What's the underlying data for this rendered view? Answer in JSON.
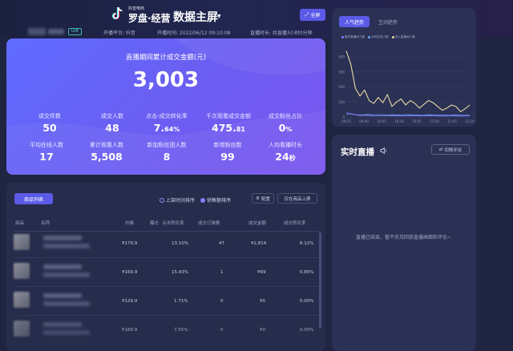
{
  "header": {
    "brand_top": "抖音电商",
    "brand_name": "罗盘·经营",
    "title": "数据主屏",
    "fullscreen_label": "全屏",
    "level_badge": "LV8",
    "platform": "开播平台: 抖音",
    "start_time": "开播时间: 2022/06/12 09:10:08",
    "duration": "直播时长: 共直播3小时0分钟"
  },
  "hero": {
    "label": "直播期间累计成交金额(元)",
    "value": "3,003",
    "metrics": [
      {
        "label": "成交件数",
        "value": "50",
        "suffix": ""
      },
      {
        "label": "成交人数",
        "value": "48",
        "suffix": ""
      },
      {
        "label": "点击-成交转化率",
        "value": "7.",
        "suffix": "64%"
      },
      {
        "label": "千次观看成交金额",
        "value": "475.",
        "suffix": "81"
      },
      {
        "label": "成交粉丝占比",
        "value": "0",
        "suffix": "%"
      },
      {
        "label": "平均在线人数",
        "value": "17",
        "suffix": ""
      },
      {
        "label": "累计观看人数",
        "value": "5,508",
        "suffix": ""
      },
      {
        "label": "新加粉丝团人数",
        "value": "8",
        "suffix": ""
      },
      {
        "label": "新增粉丝数",
        "value": "99",
        "suffix": ""
      },
      {
        "label": "人均看播时长",
        "value": "24",
        "suffix": "秒"
      }
    ]
  },
  "trend": {
    "tabs": [
      "人气趋势",
      "互动趋势"
    ],
    "legend": [
      {
        "name": "离开直播间人数",
        "color": "#8a7bff"
      },
      {
        "name": "实时在线人数",
        "color": "#6fa8ff"
      },
      {
        "name": "进入直播间人数",
        "color": "#e9d8a6"
      }
    ],
    "y_ticks": [
      "400",
      "300",
      "200",
      "100",
      "0"
    ],
    "x_ticks": [
      "09:15",
      "09:40",
      "10:05",
      "10:30",
      "10:55",
      "11:20",
      "11:45",
      "12:10"
    ],
    "chart_data": {
      "type": "line",
      "x": [
        "09:15",
        "09:40",
        "10:05",
        "10:30",
        "10:55",
        "11:20",
        "11:45",
        "12:10"
      ],
      "ylim": [
        0,
        480
      ],
      "series": [
        {
          "name": "进入直播间人数",
          "values": [
            440,
            350,
            190,
            140,
            180,
            110,
            90,
            130,
            95,
            150,
            70,
            100,
            120,
            80,
            110,
            90,
            60,
            85,
            110,
            95,
            70,
            45,
            60,
            80,
            70,
            35,
            55,
            80
          ]
        },
        {
          "name": "实时在线人数",
          "values": [
            18,
            22,
            16,
            14,
            15,
            17,
            12,
            14,
            16,
            13,
            15,
            14,
            12,
            16,
            15,
            14,
            12,
            13,
            15,
            14,
            12,
            13,
            11,
            12,
            14,
            12,
            11,
            12
          ]
        },
        {
          "name": "离开直播间人数",
          "values": [
            30,
            20,
            15,
            10,
            12,
            10,
            9,
            10,
            8,
            10,
            7,
            9,
            8,
            7,
            9,
            8,
            7,
            8,
            9,
            8,
            7,
            6,
            7,
            8,
            7,
            6,
            7,
            8
          ]
        }
      ]
    }
  },
  "live": {
    "title": "实时直播",
    "switch_label": "切换评论",
    "message": "直播已结束，暂不支持回放直播画面和评论~"
  },
  "products": {
    "tab_label": "商品列表",
    "sort_options": [
      "上架时间排序",
      "销售额排序"
    ],
    "config_label": "配置",
    "filter_label": "仅在商品上屏",
    "columns": [
      "商品",
      "名称",
      "价格",
      "曝光",
      "点击转化率",
      "成交订单数",
      "成交金额",
      "成交转化率"
    ],
    "rows": [
      {
        "price": "¥179.9",
        "click_conv": "13.10%",
        "orders": "47",
        "amount": "¥2,814",
        "conv": "8.12%"
      },
      {
        "price": "¥169.9",
        "click_conv": "15.43%",
        "orders": "1",
        "amount": "¥69",
        "conv": "0.80%"
      },
      {
        "price": "¥129.9",
        "click_conv": "1.71%",
        "orders": "0",
        "amount": "¥0",
        "conv": "0.00%"
      },
      {
        "price": "¥189.9",
        "click_conv": "7.55%",
        "orders": "0",
        "amount": "¥0",
        "conv": "0.00%"
      }
    ]
  }
}
